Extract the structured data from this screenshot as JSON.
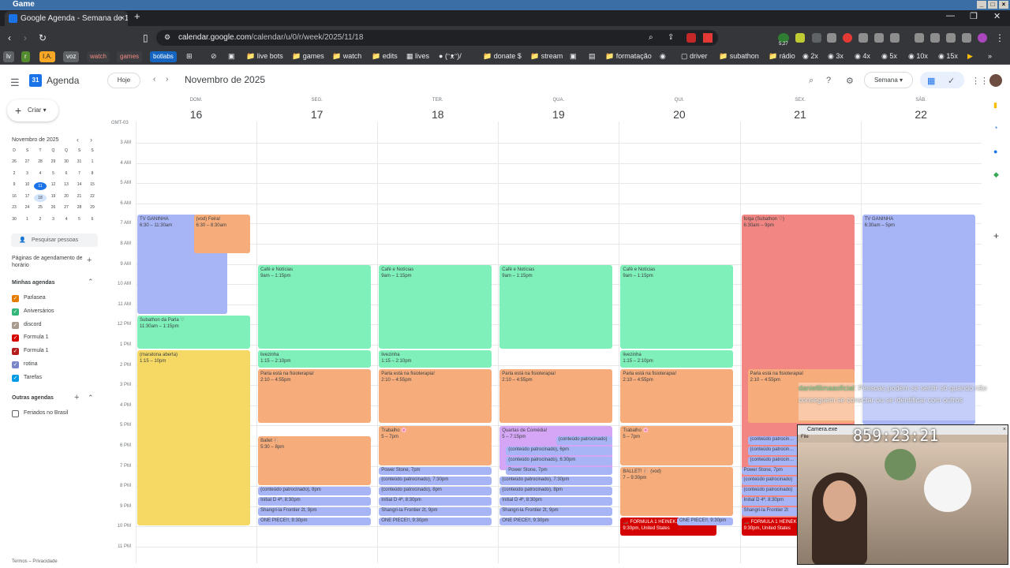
{
  "os": {
    "title": "Game"
  },
  "browser": {
    "tab_title": "Google Agenda - Semana de 16",
    "url_host": "calendar.google.com",
    "url_path": "/calendar/u/0/r/week/2025/11/18",
    "extension_badge": "5,27"
  },
  "bookmarks": {
    "chips": [
      "lv",
      "r",
      "I.A.",
      "voz",
      "watch",
      "games",
      "botlabs"
    ],
    "items": [
      "live bots",
      "games",
      "watch",
      "edits",
      "lives",
      "(ᵔᴥᵔ)/",
      "donate $",
      "stream",
      "formatação",
      "driver",
      "subathon",
      "rádio",
      "2x",
      "3x",
      "4x",
      "5x",
      "10x",
      "15x"
    ]
  },
  "header": {
    "app_name": "Agenda",
    "today_label": "Hoje",
    "month_title": "Novembro de 2025",
    "view_label": "Semana"
  },
  "sidebar": {
    "create_label": "Criar",
    "mini_title": "Novembro de 2025",
    "mini_weekdays": [
      "D",
      "S",
      "T",
      "Q",
      "Q",
      "S",
      "S"
    ],
    "mini_weeks": [
      [
        "26",
        "27",
        "28",
        "29",
        "30",
        "31",
        "1"
      ],
      [
        "2",
        "3",
        "4",
        "5",
        "6",
        "7",
        "8"
      ],
      [
        "9",
        "10",
        "11",
        "12",
        "13",
        "14",
        "15"
      ],
      [
        "16",
        "17",
        "18",
        "19",
        "20",
        "21",
        "22"
      ],
      [
        "23",
        "24",
        "25",
        "26",
        "27",
        "28",
        "29"
      ],
      [
        "30",
        "1",
        "2",
        "3",
        "4",
        "5",
        "6"
      ]
    ],
    "search_people": "Pesquisar pessoas",
    "booking_pages": "Páginas de agendamento de horário",
    "my_calendars_label": "Minhas agendas",
    "my_calendars": [
      {
        "name": "Parlasea",
        "color": "#e67c00"
      },
      {
        "name": "Aniversários",
        "color": "#33b679"
      },
      {
        "name": "discord",
        "color": "#a79b8e"
      },
      {
        "name": "Formula 1",
        "color": "#d50000"
      },
      {
        "name": "Formula 1",
        "color": "#b71c1c"
      },
      {
        "name": "rotina",
        "color": "#7986cb"
      },
      {
        "name": "Tarefas",
        "color": "#039be5"
      }
    ],
    "other_calendars_label": "Outras agendas",
    "other_calendars": [
      {
        "name": "Feriados no Brasil",
        "color": "#ffffff"
      }
    ],
    "footer": "Termos – Privacidade"
  },
  "week": {
    "timezone": "GMT-03",
    "days": [
      {
        "name": "DOM.",
        "num": "16"
      },
      {
        "name": "SEG.",
        "num": "17"
      },
      {
        "name": "TER.",
        "num": "18"
      },
      {
        "name": "QUA.",
        "num": "19"
      },
      {
        "name": "QUI.",
        "num": "20"
      },
      {
        "name": "SEX.",
        "num": "21"
      },
      {
        "name": "SÁB.",
        "num": "22"
      }
    ],
    "hours": [
      "3 AM",
      "4 AM",
      "5 AM",
      "6 AM",
      "7 AM",
      "8 AM",
      "9 AM",
      "10 AM",
      "11 AM",
      "12 PM",
      "1 PM",
      "2 PM",
      "3 PM",
      "4 PM",
      "5 PM",
      "6 PM",
      "7 PM",
      "8 PM",
      "9 PM",
      "10 PM",
      "11 PM"
    ]
  },
  "events": [
    {
      "day": 0,
      "start": 6.5,
      "end": 11.5,
      "title": "TV GANINHA",
      "time": "6:30 – 11:30am",
      "color": "blue",
      "col": 0,
      "cols": 2
    },
    {
      "day": 0,
      "start": 6.5,
      "end": 8.5,
      "title": "(vod) Feira!",
      "time": "6:30 – 8:30am",
      "color": "orange",
      "col": 1,
      "cols": 2
    },
    {
      "day": 0,
      "start": 11.5,
      "end": 13.25,
      "title": "Subathon da Parla ♡",
      "time": "11:30am – 1:15pm",
      "color": "green",
      "col": 0,
      "cols": 1
    },
    {
      "day": 0,
      "start": 13.25,
      "end": 22.0,
      "title": "(maratona aberta)",
      "time": "1:15 – 10pm",
      "color": "yellow",
      "col": 0,
      "cols": 1
    },
    {
      "day": 1,
      "start": 9.0,
      "end": 13.25,
      "title": "Café e Notícias",
      "time": "9am – 1:15pm",
      "color": "green",
      "col": 0,
      "cols": 1
    },
    {
      "day": 1,
      "start": 13.25,
      "end": 14.17,
      "title": "livezinha",
      "time": "1:15 – 2:10pm",
      "color": "green",
      "col": 0,
      "cols": 1
    },
    {
      "day": 1,
      "start": 14.17,
      "end": 16.92,
      "title": "Parla está na fisioterapia!",
      "time": "2:10 – 4:55pm",
      "color": "orange",
      "col": 0,
      "cols": 1
    },
    {
      "day": 1,
      "start": 17.5,
      "end": 20.0,
      "title": "Ballet 🩰",
      "time": "5:30 – 8pm",
      "color": "orange",
      "col": 0,
      "cols": 1
    },
    {
      "day": 1,
      "start": 20.0,
      "end": 20.5,
      "title": "(conteúdo patrocinado), 8pm",
      "time": "",
      "color": "blue",
      "col": 0,
      "cols": 1
    },
    {
      "day": 1,
      "start": 20.5,
      "end": 21.0,
      "title": "Initial D 4ª, 8:30pm",
      "time": "",
      "color": "blue",
      "col": 0,
      "cols": 1
    },
    {
      "day": 1,
      "start": 21.0,
      "end": 21.5,
      "title": "Shangri-la Frontier 2t, 9pm",
      "time": "",
      "color": "blue",
      "col": 0,
      "cols": 1
    },
    {
      "day": 1,
      "start": 21.5,
      "end": 22.0,
      "title": "ONE PIECE!!, 9:30pm",
      "time": "",
      "color": "blue",
      "col": 0,
      "cols": 1
    },
    {
      "day": 2,
      "start": 9.0,
      "end": 13.25,
      "title": "Café e Notícias",
      "time": "9am – 1:15pm",
      "color": "green",
      "col": 0,
      "cols": 1
    },
    {
      "day": 2,
      "start": 13.25,
      "end": 14.17,
      "title": "livezinha",
      "time": "1:15 – 2:10pm",
      "color": "green",
      "col": 0,
      "cols": 1
    },
    {
      "day": 2,
      "start": 14.17,
      "end": 16.92,
      "title": "Parla está na fisioterapia!",
      "time": "2:10 – 4:55pm",
      "color": "orange",
      "col": 0,
      "cols": 1
    },
    {
      "day": 2,
      "start": 17.0,
      "end": 19.0,
      "title": "Trabalho 🌸",
      "time": "5 – 7pm",
      "color": "orange",
      "col": 0,
      "cols": 1
    },
    {
      "day": 2,
      "start": 19.0,
      "end": 19.5,
      "title": "Power Stone, 7pm",
      "time": "",
      "color": "blue",
      "col": 0,
      "cols": 1
    },
    {
      "day": 2,
      "start": 19.5,
      "end": 20.0,
      "title": "(conteúdo patrocinado), 7:30pm",
      "time": "",
      "color": "blue",
      "col": 0,
      "cols": 1
    },
    {
      "day": 2,
      "start": 20.0,
      "end": 20.5,
      "title": "(conteúdo patrocinado), 8pm",
      "time": "",
      "color": "blue",
      "col": 0,
      "cols": 1
    },
    {
      "day": 2,
      "start": 20.5,
      "end": 21.0,
      "title": "Initial D 4ª, 8:30pm",
      "time": "",
      "color": "blue",
      "col": 0,
      "cols": 1
    },
    {
      "day": 2,
      "start": 21.0,
      "end": 21.5,
      "title": "Shangri-la Frontier 2t, 9pm",
      "time": "",
      "color": "blue",
      "col": 0,
      "cols": 1
    },
    {
      "day": 2,
      "start": 21.5,
      "end": 22.0,
      "title": "ONE PIECE!!, 9:30pm",
      "time": "",
      "color": "blue",
      "col": 0,
      "cols": 1
    },
    {
      "day": 3,
      "start": 9.0,
      "end": 13.25,
      "title": "Café e Notícias",
      "time": "9am – 1:15pm",
      "color": "green",
      "col": 0,
      "cols": 1
    },
    {
      "day": 3,
      "start": 14.17,
      "end": 16.92,
      "title": "Parla está na fisioterapia!",
      "time": "2:10 – 4:55pm",
      "color": "orange",
      "col": 0,
      "cols": 1
    },
    {
      "day": 3,
      "start": 17.0,
      "end": 19.25,
      "title": "Quartas de Comédia!",
      "time": "5 – 7:15pm",
      "color": "purple",
      "col": 0,
      "cols": 1
    },
    {
      "day": 3,
      "start": 17.5,
      "end": 18.0,
      "title": "(conteúdo patrocinado)",
      "time": "",
      "color": "blue",
      "col": 1,
      "cols": 2
    },
    {
      "day": 3,
      "start": 18.0,
      "end": 18.5,
      "title": "(conteúdo patrocinado), 6pm",
      "time": "",
      "color": "blue",
      "col": 0,
      "cols": 1,
      "indent": 1
    },
    {
      "day": 3,
      "start": 18.5,
      "end": 19.0,
      "title": "(conteúdo patrocinado), 6:30pm",
      "time": "",
      "color": "blue",
      "col": 0,
      "cols": 1,
      "indent": 1
    },
    {
      "day": 3,
      "start": 19.0,
      "end": 19.5,
      "title": "Power Stone, 7pm",
      "time": "",
      "color": "blue",
      "col": 0,
      "cols": 1,
      "indent": 1
    },
    {
      "day": 3,
      "start": 19.5,
      "end": 20.0,
      "title": "(conteúdo patrocinado), 7:30pm",
      "time": "",
      "color": "blue",
      "col": 0,
      "cols": 1
    },
    {
      "day": 3,
      "start": 20.0,
      "end": 20.5,
      "title": "(conteúdo patrocinado), 8pm",
      "time": "",
      "color": "blue",
      "col": 0,
      "cols": 1
    },
    {
      "day": 3,
      "start": 20.5,
      "end": 21.0,
      "title": "Initial D 4ª, 8:30pm",
      "time": "",
      "color": "blue",
      "col": 0,
      "cols": 1
    },
    {
      "day": 3,
      "start": 21.0,
      "end": 21.5,
      "title": "Shangri-la Frontier 2t, 9pm",
      "time": "",
      "color": "blue",
      "col": 0,
      "cols": 1
    },
    {
      "day": 3,
      "start": 21.5,
      "end": 22.0,
      "title": "ONE PIECE!!, 9:30pm",
      "time": "",
      "color": "blue",
      "col": 0,
      "cols": 1
    },
    {
      "day": 4,
      "start": 9.0,
      "end": 13.25,
      "title": "Café e Notícias",
      "time": "9am – 1:15pm",
      "color": "green",
      "col": 0,
      "cols": 1
    },
    {
      "day": 4,
      "start": 13.25,
      "end": 14.17,
      "title": "livezinha",
      "time": "1:15 – 2:10pm",
      "color": "green",
      "col": 0,
      "cols": 1
    },
    {
      "day": 4,
      "start": 14.17,
      "end": 16.92,
      "title": "Parla está na fisioterapia!",
      "time": "2:10 – 4:55pm",
      "color": "orange",
      "col": 0,
      "cols": 1
    },
    {
      "day": 4,
      "start": 17.0,
      "end": 19.0,
      "title": "Trabalho 🌸",
      "time": "5 – 7pm",
      "color": "orange",
      "col": 0,
      "cols": 1
    },
    {
      "day": 4,
      "start": 19.0,
      "end": 21.5,
      "title": "BALLET! 🩰 (vod)",
      "time": "7 – 9:30pm",
      "color": "orange",
      "col": 0,
      "cols": 1
    },
    {
      "day": 4,
      "start": 21.5,
      "end": 22.5,
      "title": "🏎️ FORMULA 1 HEINEK…",
      "time": "9:30pm, United States",
      "color": "crimson",
      "col": 0,
      "cols": 1,
      "narrow": 1
    },
    {
      "day": 4,
      "start": 21.5,
      "end": 22.0,
      "title": "ONE PIECE!!, 9:30pm",
      "time": "",
      "color": "blue",
      "col": 1,
      "cols": 2
    },
    {
      "day": 5,
      "start": 6.5,
      "end": 22.5,
      "title": "folga (Subathon ♡)",
      "time": "6:30am – 9pm",
      "color": "red",
      "col": 0,
      "cols": 1
    },
    {
      "day": 5,
      "start": 14.17,
      "end": 16.92,
      "title": "Parla está na fisioterapia!",
      "time": "2:10 – 4:55pm",
      "color": "orange",
      "col": 0,
      "cols": 1,
      "indent": 1
    },
    {
      "day": 5,
      "start": 17.5,
      "end": 18.0,
      "title": "(conteúdo patrocin…",
      "time": "",
      "color": "blue",
      "col": 0,
      "cols": 1,
      "indent": 1
    },
    {
      "day": 5,
      "start": 18.0,
      "end": 18.5,
      "title": "(conteúdo patrocin…",
      "time": "",
      "color": "blue",
      "col": 0,
      "cols": 1,
      "indent": 1
    },
    {
      "day": 5,
      "start": 18.5,
      "end": 19.0,
      "title": "(conteúdo patrocin…",
      "time": "",
      "color": "blue",
      "col": 0,
      "cols": 1,
      "indent": 1
    },
    {
      "day": 5,
      "start": 19.0,
      "end": 19.5,
      "title": "Power Stone, 7pm",
      "time": "",
      "color": "blue",
      "col": 0,
      "cols": 1
    },
    {
      "day": 5,
      "start": 19.5,
      "end": 20.0,
      "title": "(conteúdo patrocinado)",
      "time": "",
      "color": "blue",
      "col": 0,
      "cols": 1
    },
    {
      "day": 5,
      "start": 20.0,
      "end": 20.5,
      "title": "(conteúdo patrocinado)",
      "time": "",
      "color": "blue",
      "col": 0,
      "cols": 1
    },
    {
      "day": 5,
      "start": 20.5,
      "end": 21.0,
      "title": "Initial D 4ª, 8:30pm",
      "time": "",
      "color": "blue",
      "col": 0,
      "cols": 1
    },
    {
      "day": 5,
      "start": 21.0,
      "end": 21.5,
      "title": "Shangri-la Frontier 2t",
      "time": "",
      "color": "blue",
      "col": 0,
      "cols": 1
    },
    {
      "day": 5,
      "start": 21.5,
      "end": 22.5,
      "title": "🏎️ FORMULA 1 HEINEK…",
      "time": "9:30pm, United States",
      "color": "crimson",
      "col": 0,
      "cols": 1
    },
    {
      "day": 6,
      "start": 6.5,
      "end": 17.0,
      "title": "TV GANINHA",
      "time": "6:30am – 5pm",
      "color": "blue",
      "col": 0,
      "cols": 1
    }
  ],
  "overlay": {
    "chat_user": "danielllimaaoficial",
    "chat_message": "Pessoas podem se sentir só quando não conseguem se conectar ou se identificar com outros",
    "camera_title": "Camera.exe",
    "camera_menu": "File",
    "timer": "859:23:21"
  }
}
